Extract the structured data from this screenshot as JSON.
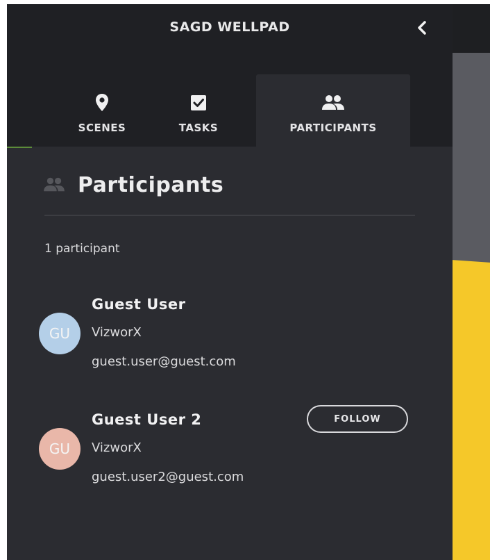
{
  "header": {
    "title": "SAGD WELLPAD"
  },
  "tabs": [
    {
      "label": "SCENES",
      "icon": "map-pin-icon"
    },
    {
      "label": "TASKS",
      "icon": "checkbox-icon"
    },
    {
      "label": "PARTICIPANTS",
      "icon": "people-icon",
      "active": true
    }
  ],
  "section": {
    "title": "Participants",
    "count_text": "1 participant"
  },
  "participants": [
    {
      "initials": "GU",
      "name": "Guest User",
      "org": "VizworX",
      "email": "guest.user@guest.com",
      "avatar_color": "#bcd8f2"
    },
    {
      "initials": "GU",
      "name": "Guest User 2",
      "org": "VizworX",
      "email": "guest.user2@guest.com",
      "avatar_color": "#f4bfb0",
      "action_label": "FOLLOW"
    }
  ],
  "colors": {
    "panel_bg": "#2b2c31",
    "header_bg": "#1f2024",
    "scene_accent": "#f5c829"
  }
}
